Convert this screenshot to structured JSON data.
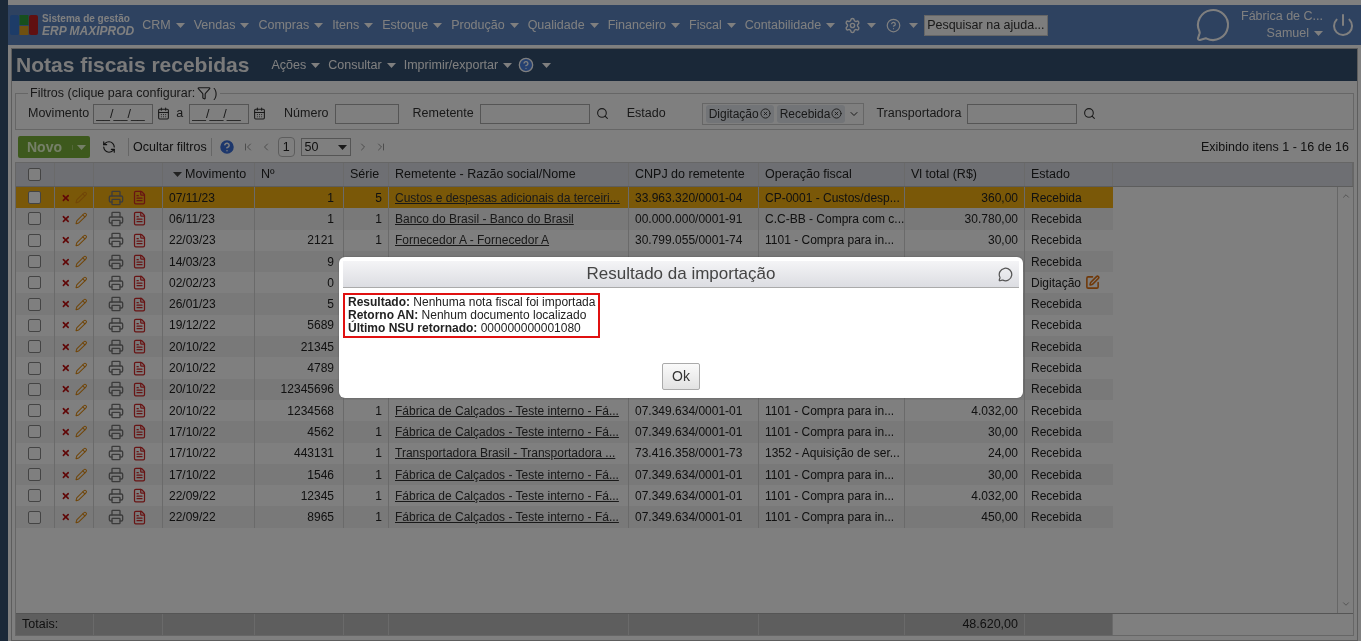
{
  "brand": {
    "line1": "Sistema de gestão",
    "line2": "ERP MAXIPROD"
  },
  "menu": [
    "CRM",
    "Vendas",
    "Compras",
    "Itens",
    "Estoque",
    "Produção",
    "Qualidade",
    "Financeiro",
    "Fiscal",
    "Contabilidade"
  ],
  "help_search": {
    "placeholder": "Pesquisar na ajuda..."
  },
  "user": {
    "company": "Fábrica de C...",
    "name": "Samuel"
  },
  "page": {
    "title": "Notas fiscais recebidas",
    "menus": [
      "Ações",
      "Consultar",
      "Imprimir/exportar"
    ]
  },
  "filters": {
    "legend": "Filtros (clique para configurar:",
    "legend_end": ")",
    "movimento_label": "Movimento",
    "date_from": "__/__/__",
    "between": "a",
    "date_to": "__/__/__",
    "numero_label": "Número",
    "remetente_label": "Remetente",
    "estado_label": "Estado",
    "estado_tags": [
      "Digitação",
      "Recebida"
    ],
    "transportadora_label": "Transportadora"
  },
  "toolbar": {
    "new_button": "Novo",
    "hide_filters": "Ocultar filtros",
    "page": "1",
    "page_size": "50",
    "summary": "Exibindo itens 1 - 16 de 16"
  },
  "table": {
    "select_all_checked": false,
    "columns": [
      {
        "label": "Movimento",
        "sorted": true
      },
      {
        "label": "Nº",
        "sorted": false
      },
      {
        "label": "Série",
        "sorted": false
      },
      {
        "label": "Remetente - Razão social/Nome",
        "sorted": false
      },
      {
        "label": "CNPJ do remetente",
        "sorted": false
      },
      {
        "label": "Operação fiscal",
        "sorted": false
      },
      {
        "label": "Vl total (R$)",
        "sorted": false
      },
      {
        "label": "Estado",
        "sorted": false
      }
    ],
    "rows": [
      {
        "selected": true,
        "checked": false,
        "movimento": "07/11/23",
        "numero": "1",
        "serie": "5",
        "remetente": "Custos e despesas adicionais da terceiri...",
        "cnpj": "33.963.320/0001-04",
        "operacao": "CP-0001 - Custos/desp...",
        "total": "360,00",
        "estado": "Recebida",
        "editable": false
      },
      {
        "selected": false,
        "checked": false,
        "movimento": "06/11/23",
        "numero": "1",
        "serie": "1",
        "remetente": "Banco do Brasil - Banco do Brasil",
        "cnpj": "00.000.000/0001-91",
        "operacao": "C.C-BB - Compra com c...",
        "total": "30.780,00",
        "estado": "Recebida",
        "editable": false
      },
      {
        "selected": false,
        "checked": false,
        "movimento": "22/03/23",
        "numero": "2121",
        "serie": "1",
        "remetente": "Fornecedor A - Fornecedor A",
        "cnpj": "30.799.055/0001-74",
        "operacao": "1101 - Compra para in...",
        "total": "30,00",
        "estado": "Recebida",
        "editable": false
      },
      {
        "selected": false,
        "checked": false,
        "movimento": "14/03/23",
        "numero": "9",
        "estado": "Recebida",
        "editable": false
      },
      {
        "selected": false,
        "checked": false,
        "movimento": "02/02/23",
        "numero": "0",
        "estado": "Digitação",
        "editable": true
      },
      {
        "selected": false,
        "checked": false,
        "movimento": "26/01/23",
        "numero": "5",
        "estado": "Recebida",
        "editable": false
      },
      {
        "selected": false,
        "checked": false,
        "movimento": "19/12/22",
        "numero": "5689",
        "estado": "Recebida",
        "editable": false
      },
      {
        "selected": false,
        "checked": false,
        "movimento": "20/10/22",
        "numero": "21345",
        "estado": "Recebida",
        "editable": false
      },
      {
        "selected": false,
        "checked": false,
        "movimento": "20/10/22",
        "numero": "4789",
        "estado": "Recebida",
        "editable": false
      },
      {
        "selected": false,
        "checked": false,
        "movimento": "20/10/22",
        "numero": "12345696",
        "estado": "Recebida",
        "editable": false
      },
      {
        "selected": false,
        "checked": false,
        "movimento": "20/10/22",
        "numero": "1234568",
        "serie": "1",
        "remetente": "Fábrica de Calçados - Teste interno - Fá...",
        "cnpj": "07.349.634/0001-01",
        "operacao": "1101 - Compra para in...",
        "total": "4.032,00",
        "estado": "Recebida",
        "editable": false
      },
      {
        "selected": false,
        "checked": false,
        "movimento": "17/10/22",
        "numero": "4562",
        "serie": "1",
        "remetente": "Fábrica de Calçados - Teste interno - Fá...",
        "cnpj": "07.349.634/0001-01",
        "operacao": "1101 - Compra para in...",
        "total": "30,00",
        "estado": "Recebida",
        "editable": false
      },
      {
        "selected": false,
        "checked": false,
        "movimento": "17/10/22",
        "numero": "443131",
        "serie": "1",
        "remetente": "Transportadora Brasil - Transportadora ...",
        "cnpj": "73.416.358/0001-73",
        "operacao": "1352 - Aquisição de ser...",
        "total": "24,00",
        "estado": "Recebida",
        "editable": false
      },
      {
        "selected": false,
        "checked": false,
        "movimento": "17/10/22",
        "numero": "1546",
        "serie": "1",
        "remetente": "Fábrica de Calçados - Teste interno - Fá...",
        "cnpj": "07.349.634/0001-01",
        "operacao": "1101 - Compra para in...",
        "total": "30,00",
        "estado": "Recebida",
        "editable": false
      },
      {
        "selected": false,
        "checked": false,
        "movimento": "22/09/22",
        "numero": "12345",
        "serie": "1",
        "remetente": "Fábrica de Calçados - Teste interno - Fá...",
        "cnpj": "07.349.634/0001-01",
        "operacao": "1101 - Compra para in...",
        "total": "4.032,00",
        "estado": "Recebida",
        "editable": false
      },
      {
        "selected": false,
        "checked": false,
        "movimento": "22/09/22",
        "numero": "8965",
        "serie": "1",
        "remetente": "Fábrica de Calçados - Teste interno - Fá...",
        "cnpj": "07.349.634/0001-01",
        "operacao": "1101 - Compra para in...",
        "total": "450,00",
        "estado": "Recebida",
        "editable": false
      }
    ],
    "totals_label": "Totais:",
    "totals_value": "48.620,00"
  },
  "dialog": {
    "title": "Resultado da importação",
    "lines": [
      {
        "label": "Resultado:",
        "value": "Nenhuma nota fiscal foi importada"
      },
      {
        "label": "Retorno AN:",
        "value": "Nenhum documento localizado"
      },
      {
        "label": "Último NSU retornado:",
        "value": "000000000001080"
      }
    ],
    "ok": "Ok"
  }
}
